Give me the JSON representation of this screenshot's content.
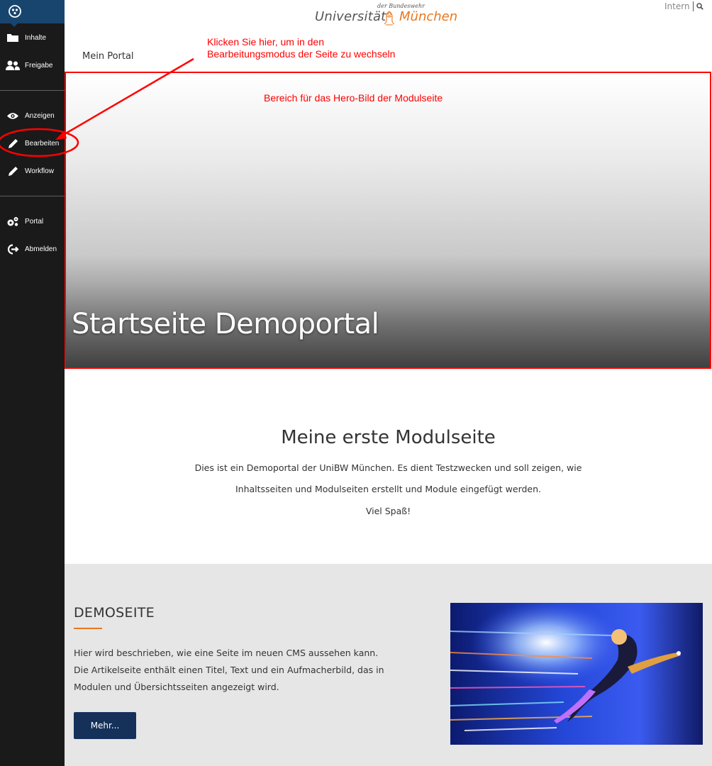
{
  "sidebar": {
    "items": [
      {
        "label": "Inhalte",
        "icon": "folder-icon"
      },
      {
        "label": "Freigabe",
        "icon": "users-icon"
      },
      {
        "label": "Anzeigen",
        "icon": "eye-icon"
      },
      {
        "label": "Bearbeiten",
        "icon": "pencil-icon"
      },
      {
        "label": "Workflow",
        "icon": "pencil-icon"
      },
      {
        "label": "Portal",
        "icon": "gears-icon"
      },
      {
        "label": "Abmelden",
        "icon": "logout-icon"
      }
    ]
  },
  "header": {
    "logo_top": "der Bundeswehr",
    "logo_left": "Universität",
    "logo_right": "München",
    "intern_link": "Intern",
    "breadcrumb": "Mein Portal"
  },
  "annotations": {
    "edit_hint_line1": "Klicken Sie hier, um in den",
    "edit_hint_line2": "Bearbeitungsmodus der Seite zu wechseln",
    "hero_hint": "Bereich für das Hero-Bild der Modulseite"
  },
  "hero": {
    "title": "Startseite Demoportal"
  },
  "intro": {
    "title": "Meine erste Modulseite",
    "line1": "Dies ist ein Demoportal der UniBW München. Es dient Testzwecken und soll zeigen, wie",
    "line2": "Inhaltsseiten und Modulseiten erstellt und Module eingefügt werden.",
    "line3": "Viel Spaß!"
  },
  "teaser": {
    "title": "DEMOSEITE",
    "line1": "Hier wird beschrieben, wie eine Seite im neuen CMS aussehen kann.",
    "line2": "Die Artikelseite enthält einen Titel, Text und ein Aufmacherbild, das in",
    "line3": "Modulen und Übersichtsseiten angezeigt wird.",
    "button": "Mehr..."
  },
  "colors": {
    "sidebar_bg": "#1a1a1a",
    "sidebar_top": "#17456e",
    "annotation": "#ff0000",
    "accent_orange": "#e8781e",
    "button_navy": "#15315a"
  }
}
